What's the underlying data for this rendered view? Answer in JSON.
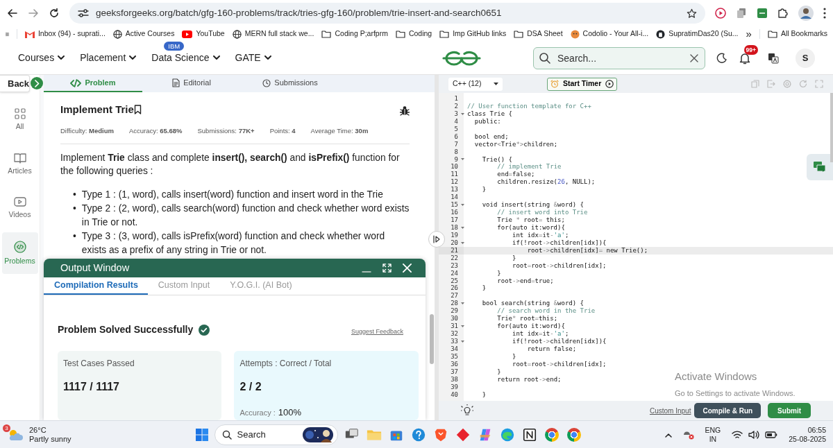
{
  "browser": {
    "url": "geeksforgeeks.org/batch/gfg-160-problems/track/tries-gfg-160/problem/trie-insert-and-search0651",
    "bookmarks": [
      {
        "label": "Inbox (94) - suprati...",
        "kind": "mail"
      },
      {
        "label": "Active Courses",
        "kind": "site"
      },
      {
        "label": "YouTube",
        "kind": "video"
      },
      {
        "label": "MERN full stack we...",
        "kind": "site"
      },
      {
        "label": "Coding P;arfprm",
        "kind": "folder"
      },
      {
        "label": "Coding",
        "kind": "folder"
      },
      {
        "label": "Imp GitHub links",
        "kind": "folder"
      },
      {
        "label": "DSA Sheet",
        "kind": "folder"
      },
      {
        "label": "Codolio - Your All-i...",
        "kind": "app"
      },
      {
        "label": "SupratimDas20 (Su...",
        "kind": "code"
      }
    ],
    "more": "»",
    "all_bookmarks": "All Bookmarks"
  },
  "site_header": {
    "nav": [
      {
        "label": "Courses"
      },
      {
        "label": "Placement"
      },
      {
        "label": "Data Science",
        "badge": "IBM"
      },
      {
        "label": "GATE"
      }
    ],
    "search": {
      "placeholder": "Search..."
    },
    "notifications": "99+",
    "avatar": "S"
  },
  "sidebar": {
    "back": "Back",
    "items": [
      {
        "label": "All",
        "kind": "grid",
        "selected": false
      },
      {
        "label": "Articles",
        "kind": "book",
        "selected": false
      },
      {
        "label": "Videos",
        "kind": "video",
        "selected": false
      },
      {
        "label": "Problems",
        "kind": "code",
        "selected": true
      }
    ]
  },
  "problem_tabs": [
    {
      "label": "Problem",
      "kind": "code",
      "selected": true
    },
    {
      "label": "Editorial",
      "kind": "doc",
      "selected": false
    },
    {
      "label": "Submissions",
      "kind": "clock",
      "selected": false
    }
  ],
  "problem": {
    "title": "Implement Trie",
    "meta": [
      "Difficulty: **Medium**",
      "Accuracy: **65.68%**",
      "Submissions: **77K+**",
      "Points: **4**",
      "Average Time: **30m**"
    ],
    "description": "Implement **Trie** class and complete **insert(), search()** and **isPrefix()** function for the following queries :",
    "queries": [
      {
        "marker": "•",
        "text": "Type 1 : (1, word), calls insert(word) function and insert word in the Trie"
      },
      {
        "marker": "•",
        "text": "Type 2 : (2, word), calls search(word) function and check whether word exists in Trie or not."
      },
      {
        "marker": "•",
        "text": "Type 3 : (3, word), calls isPrefix(word) function and check whether word exists as a prefix of any string in Trie or not."
      }
    ]
  },
  "output_window": {
    "title": "Output Window",
    "tabs": [
      {
        "label": "Compilation Results",
        "selected": true
      },
      {
        "label": "Custom Input",
        "selected": false
      },
      {
        "label": "Y.O.G.I. (AI Bot)",
        "selected": false
      }
    ],
    "status": "Problem Solved Successfully",
    "feedback": "Suggest Feedback",
    "cards": [
      {
        "label": "Test Cases Passed",
        "value": "1117 / 1117",
        "color": "#f1f6f5"
      },
      {
        "label": "Attempts : Correct / Total",
        "value": "2 / 2",
        "color": "#e9f9fd",
        "note_label": "Accuracy :",
        "note_value": "100%"
      }
    ]
  },
  "editor": {
    "language": "C++ (12)",
    "timer": "Start Timer",
    "lines": [
      {
        "n": "1",
        "fold": false,
        "active": false
      },
      {
        "n": "2",
        "fold": false,
        "active": false,
        "code": "// User function template for C++"
      },
      {
        "n": "3",
        "fold": true,
        "active": false,
        "code": "class Trie {"
      },
      {
        "n": "4",
        "fold": false,
        "active": false,
        "code": "  public:"
      },
      {
        "n": "5",
        "fold": false,
        "active": false
      },
      {
        "n": "6",
        "fold": false,
        "active": false,
        "code": "  bool end;"
      },
      {
        "n": "7",
        "fold": false,
        "active": false,
        "code": "  vector<Trie*>children;"
      },
      {
        "n": "8",
        "fold": false,
        "active": false
      },
      {
        "n": "9",
        "fold": true,
        "active": false,
        "code": "    Trie() {"
      },
      {
        "n": "10",
        "fold": false,
        "active": false,
        "code": "        // implement Trie"
      },
      {
        "n": "11",
        "fold": false,
        "active": false,
        "code": "        end=false;"
      },
      {
        "n": "12",
        "fold": false,
        "active": false,
        "code": "        children.resize(26, NULL);"
      },
      {
        "n": "13",
        "fold": false,
        "active": false,
        "code": "    }"
      },
      {
        "n": "14",
        "fold": false,
        "active": false
      },
      {
        "n": "15",
        "fold": true,
        "active": false,
        "code": "    void insert(string &word) {"
      },
      {
        "n": "16",
        "fold": false,
        "active": false,
        "code": "        // insert word into Trie"
      },
      {
        "n": "17",
        "fold": false,
        "active": false,
        "code": "        Trie * root= this;"
      },
      {
        "n": "18",
        "fold": true,
        "active": false,
        "code": "        for(auto it:word){"
      },
      {
        "n": "19",
        "fold": false,
        "active": false,
        "code": "            int idx=it-'a';"
      },
      {
        "n": "20",
        "fold": true,
        "active": false,
        "code": "            if(!root->children[idx]){"
      },
      {
        "n": "21",
        "fold": false,
        "active": true,
        "code": "                root->children[idx]= new Trie();"
      },
      {
        "n": "22",
        "fold": false,
        "active": false,
        "code": "            }"
      },
      {
        "n": "23",
        "fold": false,
        "active": false,
        "code": "            root=root->children[idx];"
      },
      {
        "n": "24",
        "fold": false,
        "active": false,
        "code": "        }"
      },
      {
        "n": "25",
        "fold": false,
        "active": false,
        "code": "        root->end=true;"
      },
      {
        "n": "26",
        "fold": false,
        "active": false,
        "code": "    }"
      },
      {
        "n": "27",
        "fold": false,
        "active": false
      },
      {
        "n": "28",
        "fold": true,
        "active": false,
        "code": "    bool search(string &word) {"
      },
      {
        "n": "29",
        "fold": false,
        "active": false,
        "code": "        // search word in the Trie"
      },
      {
        "n": "30",
        "fold": false,
        "active": false,
        "code": "        Trie* root=this;"
      },
      {
        "n": "31",
        "fold": true,
        "active": false,
        "code": "        for(auto it:word){"
      },
      {
        "n": "32",
        "fold": false,
        "active": false,
        "code": "            int idx=it-'a';"
      },
      {
        "n": "33",
        "fold": true,
        "active": false,
        "code": "            if(!root->children[idx]){"
      },
      {
        "n": "34",
        "fold": false,
        "active": false,
        "code": "                return false;"
      },
      {
        "n": "35",
        "fold": false,
        "active": false,
        "code": "            }"
      },
      {
        "n": "36",
        "fold": false,
        "active": false,
        "code": "            root=root->children[idx];"
      },
      {
        "n": "37",
        "fold": false,
        "active": false,
        "code": "        }"
      },
      {
        "n": "38",
        "fold": false,
        "active": false,
        "code": "        return root->end;"
      },
      {
        "n": "39",
        "fold": false,
        "active": false
      },
      {
        "n": "40",
        "fold": false,
        "active": false,
        "code": "    }"
      }
    ],
    "footer": {
      "custom_input": "Custom Input",
      "compile": "Compile & Run",
      "submit": "Submit"
    }
  },
  "os_notice": {
    "title": "Activate Windows",
    "text": "Go to Settings to activate Windows."
  },
  "taskbar": {
    "weather": {
      "badge": "3",
      "temp": "26°C",
      "text": "Partly sunny"
    },
    "search": "Search",
    "language": [
      "ENG",
      "IN"
    ],
    "time": "06:55",
    "date": "25-08-2025"
  }
}
